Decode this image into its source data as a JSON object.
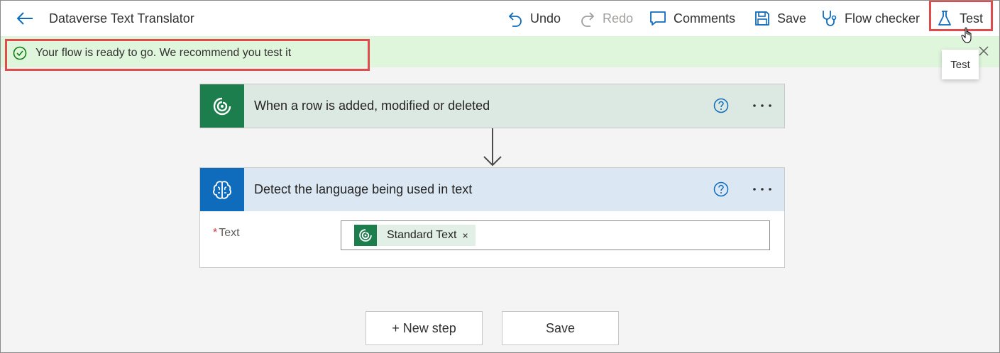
{
  "header": {
    "back_icon": "back-arrow-icon",
    "title": "Dataverse Text Translator",
    "undo": "Undo",
    "redo": "Redo",
    "comments": "Comments",
    "save": "Save",
    "flow_checker": "Flow checker",
    "test": "Test"
  },
  "notification": {
    "text": "Your flow is ready to go. We recommend you test it",
    "status_color": "#dff6dd",
    "icon": "check-circle-icon"
  },
  "tooltip": {
    "text": "Test"
  },
  "trigger": {
    "title": "When a row is added, modified or deleted",
    "icon": "dataverse-icon",
    "color": "#1c7d4d"
  },
  "action": {
    "title": "Detect the language being used in text",
    "icon": "ai-brain-icon",
    "color": "#0f6cbd",
    "fields": [
      {
        "required_mark": "*",
        "label": "Text",
        "token": "Standard Text",
        "token_remove": "×"
      }
    ]
  },
  "footer": {
    "new_step": "+ New step",
    "save": "Save"
  }
}
